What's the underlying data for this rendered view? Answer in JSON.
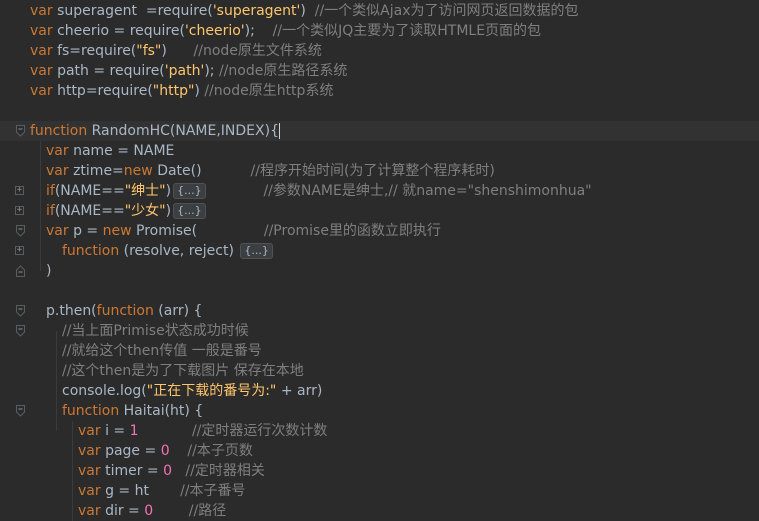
{
  "lines": [
    {
      "segments": [
        {
          "t": "var ",
          "c": "kw"
        },
        {
          "t": "superagent  =require(",
          "c": "fn"
        },
        {
          "t": "'superagent'",
          "c": "str"
        },
        {
          "t": ")  ",
          "c": "fn"
        },
        {
          "t": "//一个类似Ajax为了访问网页返回数据的包",
          "c": "cmt"
        }
      ]
    },
    {
      "segments": [
        {
          "t": "var ",
          "c": "kw"
        },
        {
          "t": "cheerio = require(",
          "c": "fn"
        },
        {
          "t": "'cheerio'",
          "c": "str"
        },
        {
          "t": ");    ",
          "c": "fn"
        },
        {
          "t": "//一个类似JQ主要为了读取HTMLE页面的包",
          "c": "cmt"
        }
      ]
    },
    {
      "segments": [
        {
          "t": "var ",
          "c": "kw"
        },
        {
          "t": "fs=require(",
          "c": "fn"
        },
        {
          "t": "\"fs\"",
          "c": "str"
        },
        {
          "t": ")      ",
          "c": "fn"
        },
        {
          "t": "//node原生文件系统",
          "c": "cmt"
        }
      ]
    },
    {
      "segments": [
        {
          "t": "var ",
          "c": "kw"
        },
        {
          "t": "path = require(",
          "c": "fn"
        },
        {
          "t": "'path'",
          "c": "str"
        },
        {
          "t": "); ",
          "c": "fn"
        },
        {
          "t": "//node原生路径系统",
          "c": "cmt"
        }
      ]
    },
    {
      "segments": [
        {
          "t": "var ",
          "c": "kw"
        },
        {
          "t": "http=require(",
          "c": "fn"
        },
        {
          "t": "\"http\"",
          "c": "str"
        },
        {
          "t": ") ",
          "c": "fn"
        },
        {
          "t": "//node原生http系统",
          "c": "cmt"
        }
      ]
    },
    {
      "segments": []
    },
    {
      "segments": [
        {
          "t": "function ",
          "c": "kw"
        },
        {
          "t": "RandomHC(NAME,INDEX)",
          "c": "fn"
        },
        {
          "t": "{",
          "c": "fn"
        }
      ]
    },
    {
      "segments": [
        {
          "t": "var ",
          "c": "kw"
        },
        {
          "t": "name = NAME",
          "c": "fn"
        }
      ]
    },
    {
      "segments": [
        {
          "t": "var ",
          "c": "kw"
        },
        {
          "t": "ztime=",
          "c": "fn"
        },
        {
          "t": "new ",
          "c": "kw"
        },
        {
          "t": "Date()           ",
          "c": "fn"
        },
        {
          "t": "//程序开始时间(为了计算整个程序耗时)",
          "c": "cmt"
        }
      ]
    },
    {
      "segments": [
        {
          "t": "if",
          "c": "kw"
        },
        {
          "t": "(NAME==",
          "c": "fn"
        },
        {
          "t": "\"绅士\"",
          "c": "str"
        },
        {
          "t": ")",
          "c": "fn"
        }
      ]
    },
    {
      "segments": [
        {
          "t": "if",
          "c": "kw"
        },
        {
          "t": "(NAME==",
          "c": "fn"
        },
        {
          "t": "\"少女\"",
          "c": "str"
        },
        {
          "t": ")",
          "c": "fn"
        }
      ]
    },
    {
      "segments": [
        {
          "t": "var ",
          "c": "kw"
        },
        {
          "t": "p = ",
          "c": "fn"
        },
        {
          "t": "new ",
          "c": "kw"
        },
        {
          "t": "Promise(               ",
          "c": "fn"
        },
        {
          "t": "//Promise里的函数立即执行",
          "c": "cmt"
        }
      ]
    },
    {
      "segments": [
        {
          "t": "function ",
          "c": "kw"
        },
        {
          "t": "(resolve, reject) ",
          "c": "fn"
        }
      ]
    },
    {
      "segments": [
        {
          "t": ")",
          "c": "fn"
        }
      ]
    },
    {
      "segments": []
    },
    {
      "segments": [
        {
          "t": "p.then(",
          "c": "fn"
        },
        {
          "t": "function ",
          "c": "kw"
        },
        {
          "t": "(arr) {",
          "c": "fn"
        }
      ]
    },
    {
      "segments": [
        {
          "t": "//当上面Primise状态成功时候",
          "c": "cmt"
        }
      ]
    },
    {
      "segments": [
        {
          "t": "//就给这个then传值 一般是番号",
          "c": "cmt"
        }
      ]
    },
    {
      "segments": [
        {
          "t": "//这个then是为了下载图片 保存在本地",
          "c": "cmt"
        }
      ]
    },
    {
      "segments": [
        {
          "t": "console.log(",
          "c": "fn"
        },
        {
          "t": "\"正在下载的番号为:\"",
          "c": "str"
        },
        {
          "t": " + arr)",
          "c": "fn"
        }
      ]
    },
    {
      "segments": [
        {
          "t": "function ",
          "c": "kw"
        },
        {
          "t": "Haitai(ht) {",
          "c": "fn"
        }
      ]
    },
    {
      "segments": [
        {
          "t": "var ",
          "c": "kw"
        },
        {
          "t": "i = ",
          "c": "fn"
        },
        {
          "t": "1",
          "c": "num"
        },
        {
          "t": "            ",
          "c": "fn"
        },
        {
          "t": "//定时器运行次数计数",
          "c": "cmt"
        }
      ]
    },
    {
      "segments": [
        {
          "t": "var ",
          "c": "kw"
        },
        {
          "t": "page = ",
          "c": "fn"
        },
        {
          "t": "0",
          "c": "num"
        },
        {
          "t": "    ",
          "c": "fn"
        },
        {
          "t": "//本子页数",
          "c": "cmt"
        }
      ]
    },
    {
      "segments": [
        {
          "t": "var ",
          "c": "kw"
        },
        {
          "t": "timer = ",
          "c": "fn"
        },
        {
          "t": "0",
          "c": "num"
        },
        {
          "t": "   ",
          "c": "fn"
        },
        {
          "t": "//定时器相关",
          "c": "cmt"
        }
      ]
    },
    {
      "segments": [
        {
          "t": "var ",
          "c": "kw"
        },
        {
          "t": "g = ht       ",
          "c": "fn"
        },
        {
          "t": "//本子番号",
          "c": "cmt"
        }
      ]
    },
    {
      "segments": [
        {
          "t": "var ",
          "c": "kw"
        },
        {
          "t": "dir = ",
          "c": "fn"
        },
        {
          "t": "0",
          "c": "num"
        },
        {
          "t": "        ",
          "c": "fn"
        },
        {
          "t": "//路径",
          "c": "cmt"
        }
      ]
    }
  ],
  "collapsed_placeholder": "{...}",
  "inline_after_if_1": "//参数NAME是绅士,// 就name=\"shenshimonhua\""
}
